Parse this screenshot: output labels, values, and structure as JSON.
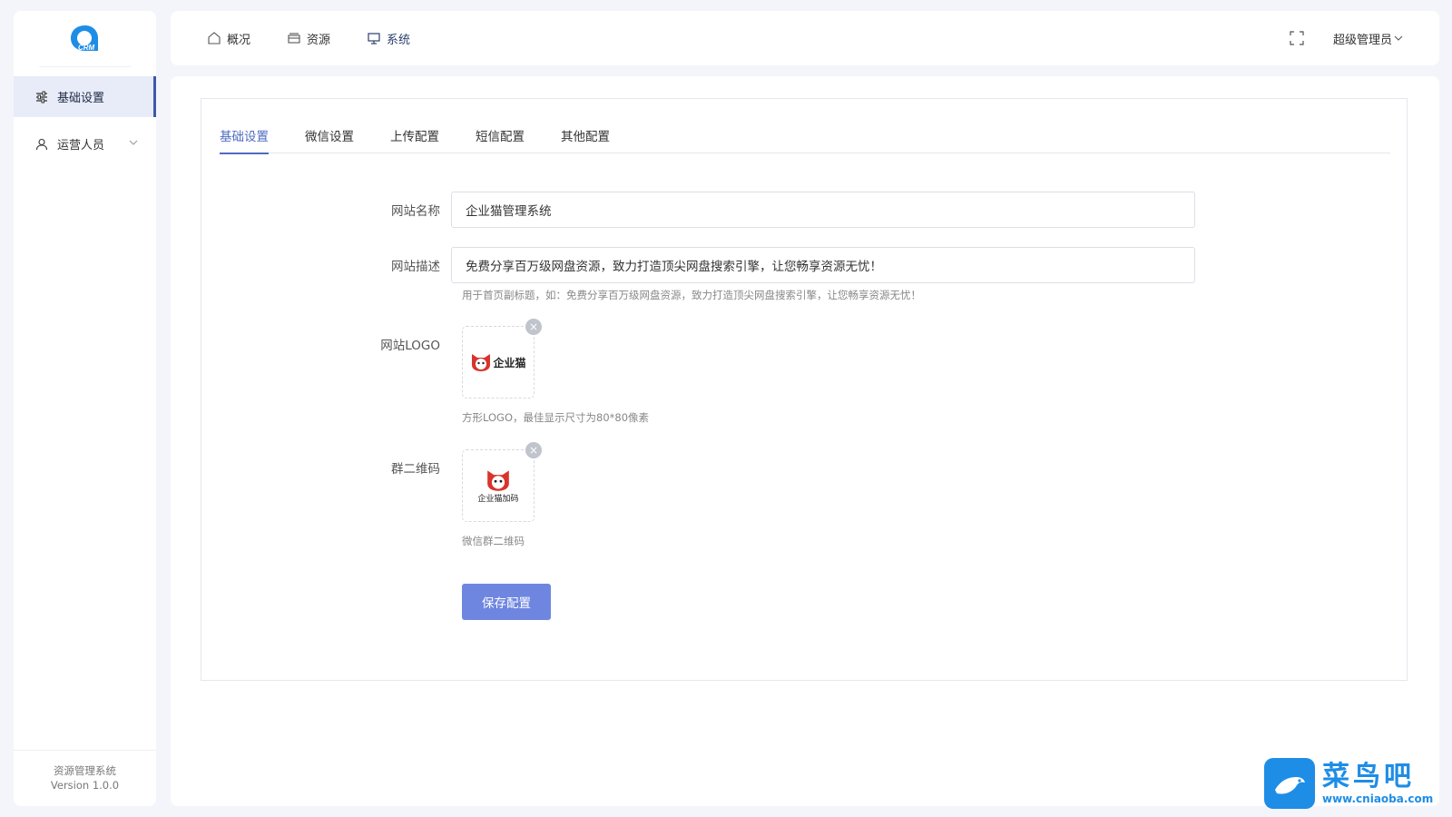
{
  "sidebar": {
    "logo_text": "CRM",
    "items": [
      {
        "label": "基础设置",
        "icon": "sliders-icon",
        "active": true
      },
      {
        "label": "运营人员",
        "icon": "user-icon",
        "active": false
      }
    ],
    "footer_title": "资源管理系统",
    "footer_version": "Version 1.0.0"
  },
  "topnav": {
    "items": [
      {
        "label": "概况",
        "icon": "home-icon"
      },
      {
        "label": "资源",
        "icon": "folder-icon"
      },
      {
        "label": "系统",
        "icon": "monitor-icon"
      }
    ],
    "user": "超级管理员"
  },
  "tabs": [
    "基础设置",
    "微信设置",
    "上传配置",
    "短信配置",
    "其他配置"
  ],
  "form": {
    "site_name_label": "网站名称",
    "site_name_value": "企业猫管理系统",
    "site_desc_label": "网站描述",
    "site_desc_value": "免费分享百万级网盘资源，致力打造顶尖网盘搜索引擎，让您畅享资源无忧！",
    "site_desc_hint": "用于首页副标题，如：免费分享百万级网盘资源，致力打造顶尖网盘搜索引擎，让您畅享资源无忧！",
    "logo_label": "网站LOGO",
    "logo_image_text": "企业猫",
    "logo_hint": "方形LOGO，最佳显示尺寸为80*80像素",
    "qr_label": "群二维码",
    "qr_image_text": "企业猫加码",
    "qr_hint": "微信群二维码",
    "save_label": "保存配置"
  },
  "watermark": {
    "cn": "菜鸟吧",
    "url": "www.cniaoba.com"
  },
  "colors": {
    "accent": "#4f6bc2",
    "button": "#6f86e0",
    "logo_red": "#d9342b",
    "watermark": "#1e8de6"
  }
}
